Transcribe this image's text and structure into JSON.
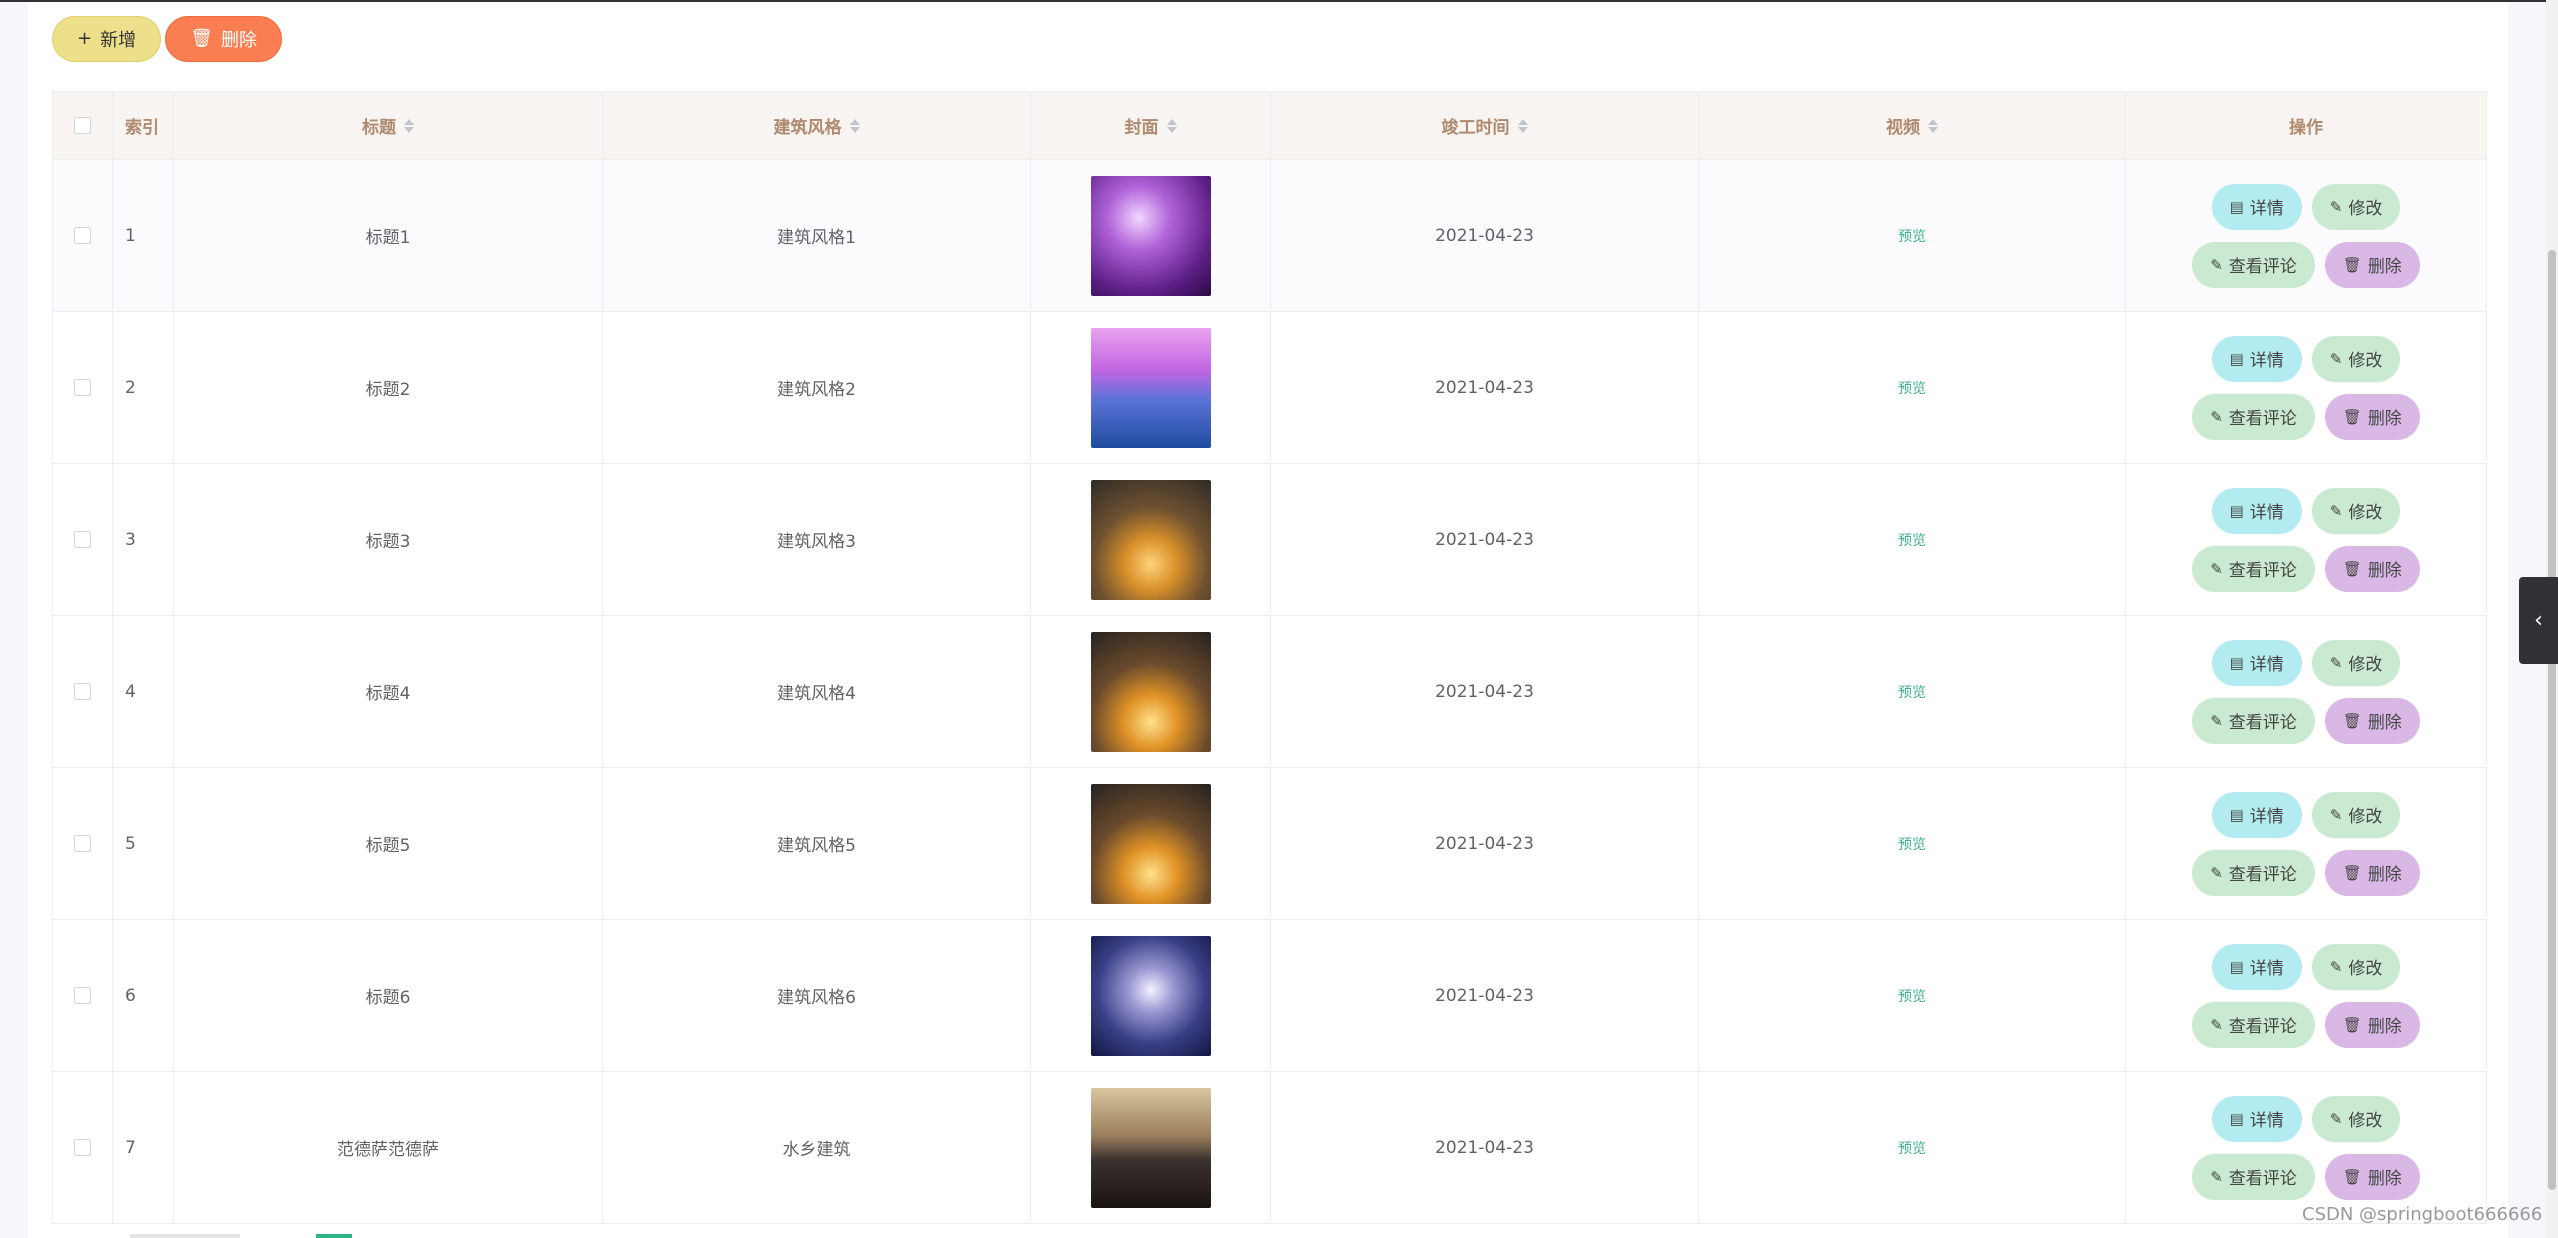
{
  "toolbar": {
    "add": {
      "icon": "plus-icon",
      "label": "新增"
    },
    "delete": {
      "icon": "trash-icon",
      "label": "删除"
    }
  },
  "table": {
    "columns": [
      "索引",
      "标题",
      "建筑风格",
      "封面",
      "竣工时间",
      "视频",
      "操作"
    ],
    "rows": [
      {
        "index": "1",
        "title": "标题1",
        "style": "建筑风格1",
        "date": "2021-04-23",
        "video": "预览"
      },
      {
        "index": "2",
        "title": "标题2",
        "style": "建筑风格2",
        "date": "2021-04-23",
        "video": "预览"
      },
      {
        "index": "3",
        "title": "标题3",
        "style": "建筑风格3",
        "date": "2021-04-23",
        "video": "预览"
      },
      {
        "index": "4",
        "title": "标题4",
        "style": "建筑风格4",
        "date": "2021-04-23",
        "video": "预览"
      },
      {
        "index": "5",
        "title": "标题5",
        "style": "建筑风格5",
        "date": "2021-04-23",
        "video": "预览"
      },
      {
        "index": "6",
        "title": "标题6",
        "style": "建筑风格6",
        "date": "2021-04-23",
        "video": "预览"
      },
      {
        "index": "7",
        "title": "范德萨范德萨",
        "style": "水乡建筑",
        "date": "2021-04-23",
        "video": "预览"
      }
    ],
    "actions": {
      "detail": "详情",
      "edit": "修改",
      "comment": "查看评论",
      "delete": "删除"
    }
  },
  "watermark": "CSDN @springboot666666"
}
